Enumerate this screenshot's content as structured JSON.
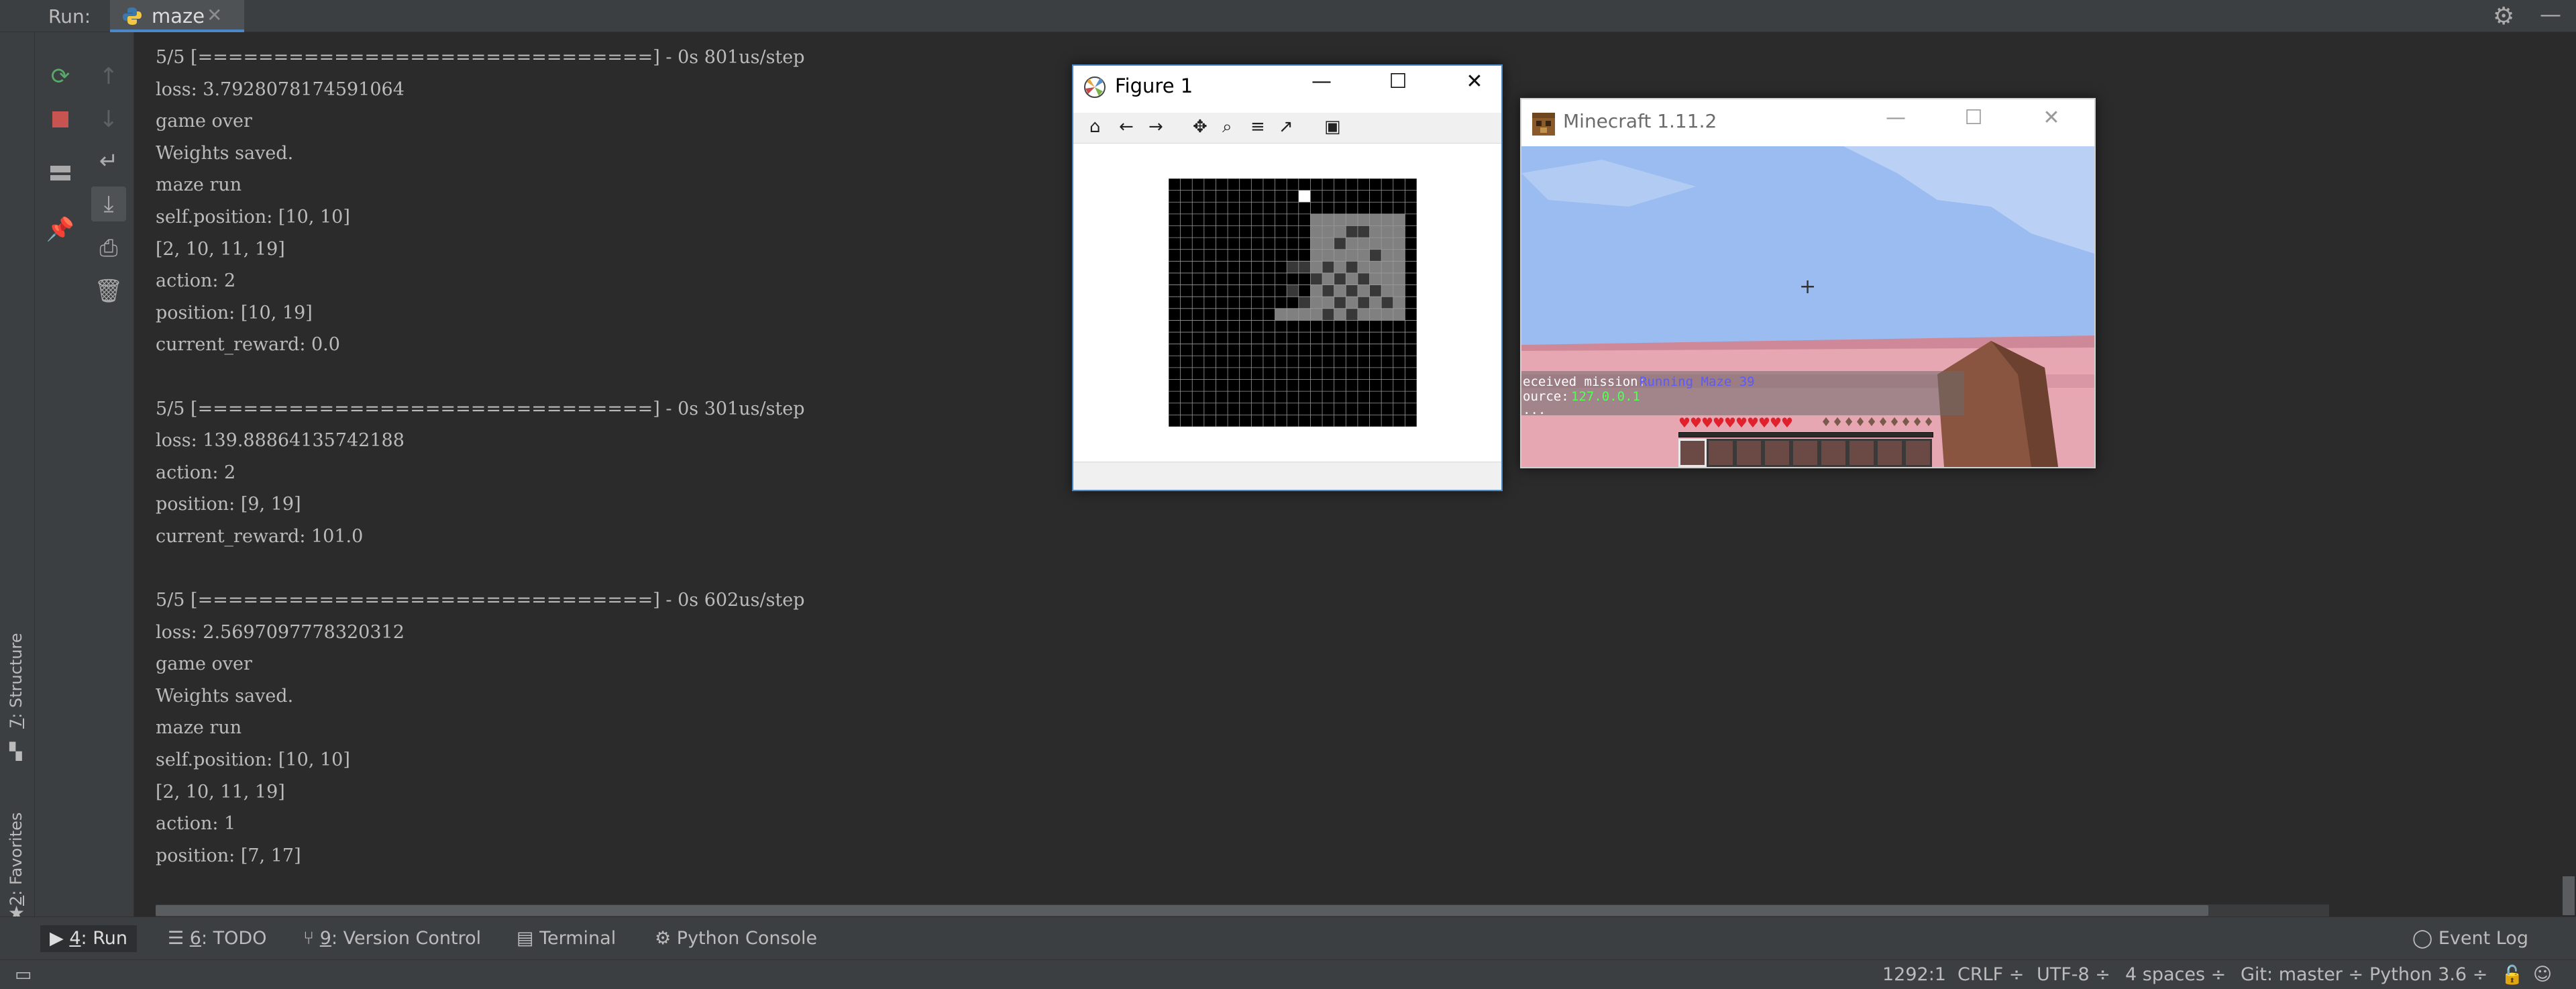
{
  "run_header": {
    "label": "Run:",
    "tab_label": "maze",
    "tab_close": "✕"
  },
  "console_lines": [
    "5/5 [==============================] - 0s 801us/step",
    "loss: 3.7928078174591064",
    "game over",
    "Weights saved.",
    "maze run",
    "self.position: [10, 10]",
    "[2, 10, 11, 19]",
    "action: 2",
    "position: [10, 19]",
    "current_reward: 0.0",
    "",
    "5/5 [==============================] - 0s 301us/step",
    "loss: 139.88864135742188",
    "action: 2",
    "position: [9, 19]",
    "current_reward: 101.0",
    "",
    "5/5 [==============================] - 0s 602us/step",
    "loss: 2.5697097778320312",
    "game over",
    "Weights saved.",
    "maze run",
    "self.position: [10, 10]",
    "[2, 10, 11, 19]",
    "action: 1",
    "position: [7, 17]"
  ],
  "left_stripe": {
    "structure_num": "7",
    "structure_label": ": Structure",
    "favorites_num": "2",
    "favorites_label": ": Favorites"
  },
  "tool_windows": [
    {
      "num": "4",
      "label": ": Run"
    },
    {
      "num": "6",
      "label": ": TODO"
    },
    {
      "num": "9",
      "label": ": Version Control"
    },
    {
      "num": "",
      "label": "Terminal"
    },
    {
      "num": "",
      "label": "Python Console"
    }
  ],
  "event_log_label": "Event Log",
  "status_bar": {
    "position": "1292:1",
    "line_sep": "CRLF ÷",
    "encoding": "UTF-8 ÷",
    "indent": "4 spaces ÷",
    "git": "Git: master ÷",
    "interpreter": "Python 3.6 ÷"
  },
  "figure_window": {
    "title": "Figure 1",
    "grid_size": 21,
    "light_cells": [
      [
        12,
        3
      ],
      [
        13,
        3
      ],
      [
        14,
        3
      ],
      [
        15,
        3
      ],
      [
        16,
        3
      ],
      [
        17,
        3
      ],
      [
        18,
        3
      ],
      [
        19,
        3
      ],
      [
        12,
        4
      ],
      [
        13,
        4
      ],
      [
        14,
        4
      ],
      [
        15,
        4
      ],
      [
        16,
        4
      ],
      [
        17,
        4
      ],
      [
        18,
        4
      ],
      [
        19,
        4
      ],
      [
        12,
        5
      ],
      [
        13,
        5
      ],
      [
        14,
        5
      ],
      [
        15,
        5
      ],
      [
        16,
        5
      ],
      [
        17,
        5
      ],
      [
        18,
        5
      ],
      [
        19,
        5
      ],
      [
        12,
        6
      ],
      [
        13,
        6
      ],
      [
        14,
        6
      ],
      [
        15,
        6
      ],
      [
        16,
        6
      ],
      [
        17,
        6
      ],
      [
        18,
        6
      ],
      [
        19,
        6
      ],
      [
        12,
        7
      ],
      [
        13,
        7
      ],
      [
        14,
        7
      ],
      [
        15,
        7
      ],
      [
        16,
        7
      ],
      [
        17,
        7
      ],
      [
        18,
        7
      ],
      [
        19,
        7
      ],
      [
        12,
        8
      ],
      [
        13,
        8
      ],
      [
        14,
        8
      ],
      [
        15,
        8
      ],
      [
        16,
        8
      ],
      [
        17,
        8
      ],
      [
        18,
        8
      ],
      [
        19,
        8
      ],
      [
        12,
        9
      ],
      [
        13,
        9
      ],
      [
        14,
        9
      ],
      [
        15,
        9
      ],
      [
        16,
        9
      ],
      [
        17,
        9
      ],
      [
        18,
        9
      ],
      [
        19,
        9
      ],
      [
        12,
        10
      ],
      [
        13,
        10
      ],
      [
        14,
        10
      ],
      [
        15,
        10
      ],
      [
        16,
        10
      ],
      [
        17,
        10
      ],
      [
        18,
        10
      ],
      [
        19,
        10
      ],
      [
        9,
        11
      ],
      [
        10,
        11
      ],
      [
        11,
        11
      ],
      [
        12,
        11
      ],
      [
        13,
        11
      ],
      [
        14,
        11
      ],
      [
        15,
        11
      ],
      [
        16,
        11
      ],
      [
        17,
        11
      ],
      [
        18,
        11
      ],
      [
        19,
        11
      ]
    ],
    "dark_cells": [
      [
        15,
        4
      ],
      [
        16,
        4
      ],
      [
        14,
        5
      ],
      [
        17,
        6
      ],
      [
        10,
        7
      ],
      [
        11,
        7
      ],
      [
        13,
        7
      ],
      [
        15,
        7
      ],
      [
        12,
        8
      ],
      [
        14,
        8
      ],
      [
        16,
        8
      ],
      [
        10,
        9
      ],
      [
        13,
        9
      ],
      [
        15,
        9
      ],
      [
        17,
        9
      ],
      [
        11,
        10
      ],
      [
        14,
        10
      ],
      [
        16,
        10
      ],
      [
        18,
        10
      ],
      [
        13,
        11
      ],
      [
        15,
        11
      ]
    ],
    "agent_cell": [
      11,
      1
    ],
    "colors": {
      "background": "#000000",
      "light": "#808080",
      "dark": "#383838",
      "agent": "#ffffff",
      "grid": "#9a9a9a"
    }
  },
  "minecraft_window": {
    "title": "Minecraft 1.11.2",
    "chat_line1_label": "eceived mission:",
    "chat_line1_value": "Running Maze 39",
    "chat_line2_label": "ource:",
    "chat_line2_value": "127.0.0.1",
    "chat_line3": "...",
    "hearts": 10,
    "armor": 10,
    "hotbar_slots": 9
  }
}
